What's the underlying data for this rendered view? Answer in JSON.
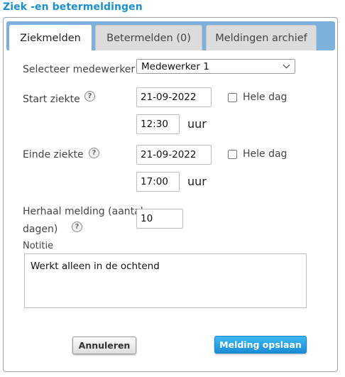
{
  "title": "Ziek -en betermeldingen",
  "tabs": [
    {
      "label": "Ziekmelden",
      "active": true
    },
    {
      "label": "Betermelden (0)",
      "active": false
    },
    {
      "label": "Meldingen archief",
      "active": false
    }
  ],
  "form": {
    "employee_label": "Selecteer medewerker",
    "employee_value": "Medewerker 1",
    "start_label": "Start ziekte",
    "start_date": "21-09-2022",
    "start_time": "12:30",
    "end_label": "Einde ziekte",
    "end_date": "21-09-2022",
    "end_time": "17:00",
    "hour_unit": "uur",
    "full_day_label": "Hele dag",
    "start_full_day_checked": false,
    "end_full_day_checked": false,
    "repeat_label_line1": "Herhaal melding (aantal",
    "repeat_label_line2": "dagen)",
    "repeat_value": "10",
    "note_label": "Notitie",
    "note_value": "Werkt alleen in de ochtend",
    "help_glyph": "?"
  },
  "buttons": {
    "cancel": "Annuleren",
    "save": "Melding opslaan"
  },
  "colors": {
    "title": "#1a8fd0",
    "tabbar": "#7db1dc",
    "save_button": "#1a8ed6"
  }
}
